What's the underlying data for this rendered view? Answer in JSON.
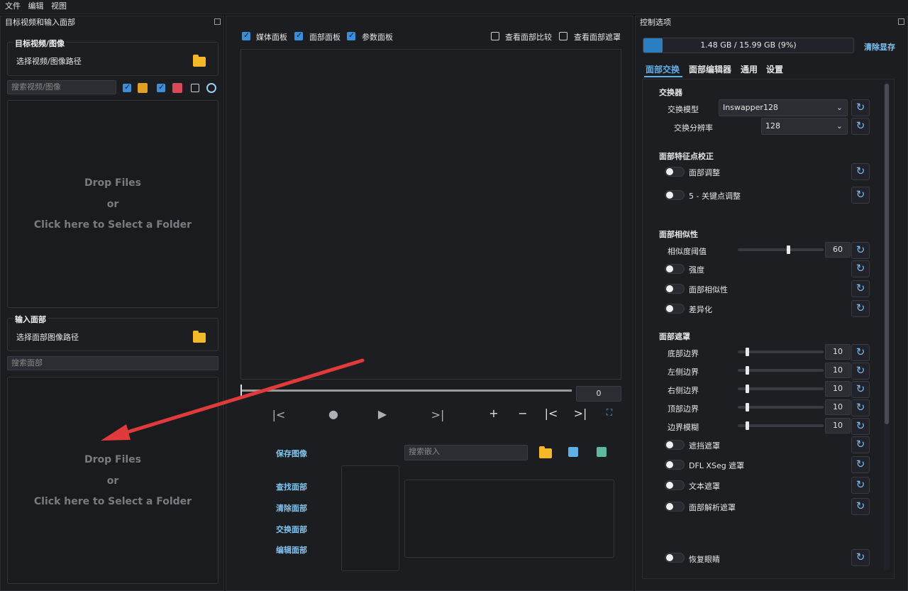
{
  "menu": [
    "文件",
    "编辑",
    "视图"
  ],
  "left_panel": {
    "title": "目标视频和输入面部",
    "target_group": {
      "title": "目标视频/图像",
      "path_label": "选择视频/图像路径"
    },
    "search_videos_placeholder": "搜索视频/图像",
    "dropzone": {
      "line1": "Drop Files",
      "line2": "or",
      "line3": "Click here to Select a Folder"
    },
    "input_group": {
      "title": "输入面部",
      "path_label": "选择面部图像路径"
    },
    "search_faces_placeholder": "搜索面部",
    "dropzone2": {
      "line1": "Drop Files",
      "line2": "or",
      "line3": "Click here to Select a Folder"
    }
  },
  "center_panel": {
    "checks": [
      {
        "label": "媒体面板",
        "checked": true
      },
      {
        "label": "面部面板",
        "checked": true
      },
      {
        "label": "参数面板",
        "checked": true
      }
    ],
    "right_checks": [
      {
        "label": "查看面部比较",
        "checked": false
      },
      {
        "label": "查看面部遮罩",
        "checked": false
      }
    ],
    "frame_value": "0",
    "save_image_label": "保存图像",
    "search_embed_placeholder": "搜索嵌入",
    "actions": [
      "查找面部",
      "清除面部",
      "交换面部",
      "编辑面部"
    ]
  },
  "right_panel": {
    "title": "控制选项",
    "memory_text": "1.48 GB / 15.99 GB (9%)",
    "memory_fraction": 0.09,
    "clear_memory": "清除显存",
    "tabs": [
      "面部交换",
      "面部编辑器",
      "通用",
      "设置"
    ],
    "swapper": {
      "title": "交换器",
      "model_label": "交换模型",
      "model_value": "Inswapper128",
      "res_label": "交换分辨率",
      "res_value": "128"
    },
    "landmark": {
      "title": "面部特征点校正",
      "toggles": [
        "面部调整",
        "5 - 关键点调整"
      ]
    },
    "similarity": {
      "title": "面部相似性",
      "threshold_label": "相似度阈值",
      "threshold_value": "60",
      "toggles": [
        "强度",
        "面部相似性",
        "差异化"
      ]
    },
    "mask": {
      "title": "面部遮罩",
      "sliders": [
        {
          "label": "底部边界",
          "value": "10"
        },
        {
          "label": "左侧边界",
          "value": "10"
        },
        {
          "label": "右侧边界",
          "value": "10"
        },
        {
          "label": "顶部边界",
          "value": "10"
        },
        {
          "label": "边界模糊",
          "value": "10"
        }
      ],
      "toggles": [
        "遮挡遮罩",
        "DFL XSeg 遮罩",
        "文本遮罩",
        "面部解析遮罩"
      ]
    },
    "restore_eyes": "恢复眼睛"
  },
  "colors": {
    "accent": "#5fb0e8",
    "checkbox": "#3a8fd8",
    "folder": "#f4b928",
    "arrow": "#e03a3a"
  }
}
